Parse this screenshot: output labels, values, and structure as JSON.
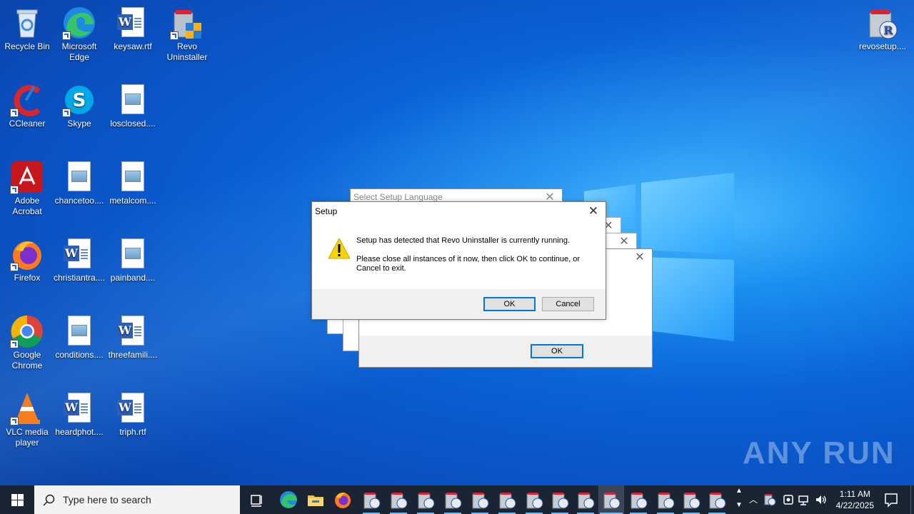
{
  "desktop": {
    "icons": [
      {
        "label": "Recycle Bin",
        "icon": "recycle-bin-icon"
      },
      {
        "label": "Microsoft Edge",
        "icon": "edge-icon"
      },
      {
        "label": "keysaw.rtf",
        "icon": "word-doc-icon"
      },
      {
        "label": "Revo Uninstaller",
        "icon": "revo-icon"
      },
      {
        "label": "CCleaner",
        "icon": "ccleaner-icon"
      },
      {
        "label": "Skype",
        "icon": "skype-icon"
      },
      {
        "label": "losclosed....",
        "icon": "image-file-icon"
      },
      {
        "label": "Adobe Acrobat",
        "icon": "acrobat-icon"
      },
      {
        "label": "chancetoo....",
        "icon": "image-file-icon"
      },
      {
        "label": "metalcom....",
        "icon": "image-file-icon"
      },
      {
        "label": "Firefox",
        "icon": "firefox-icon"
      },
      {
        "label": "christiantra....",
        "icon": "word-doc-icon"
      },
      {
        "label": "painband....",
        "icon": "image-file-icon"
      },
      {
        "label": "Google Chrome",
        "icon": "chrome-icon"
      },
      {
        "label": "conditions....",
        "icon": "image-file-icon"
      },
      {
        "label": "threefamili....",
        "icon": "word-doc-icon"
      },
      {
        "label": "VLC media player",
        "icon": "vlc-icon"
      },
      {
        "label": "heardphot....",
        "icon": "word-doc-icon"
      },
      {
        "label": "triph.rtf",
        "icon": "word-doc-icon"
      },
      {
        "label": "revosetup....",
        "icon": "revo-setup-icon"
      }
    ]
  },
  "dialogs": {
    "language": {
      "title": "Select Setup Language"
    },
    "back": {
      "ok_label": "OK"
    },
    "setup": {
      "title": "Setup",
      "message_line1": "Setup has detected that Revo Uninstaller is currently running.",
      "message_line2": "Please close all instances of it now, then click OK to continue, or Cancel to exit.",
      "ok_label": "OK",
      "cancel_label": "Cancel"
    }
  },
  "taskbar": {
    "search_placeholder": "Type here to search",
    "time": "1:11 AM",
    "date": "4/22/2025"
  },
  "watermark": "ANY RUN",
  "colors": {
    "accent": "#0078d7",
    "taskbar": "#1a2433"
  }
}
